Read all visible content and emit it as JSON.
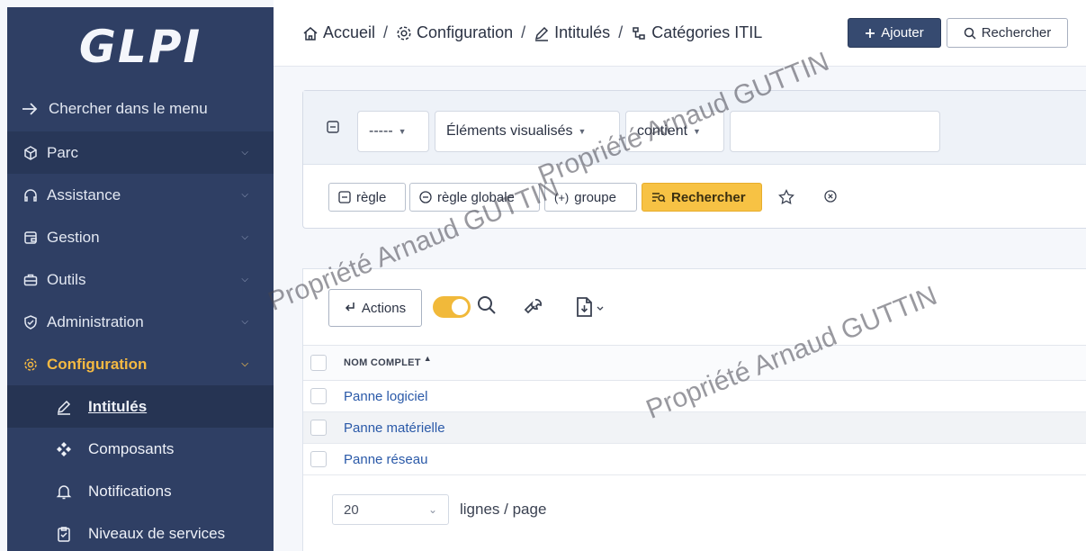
{
  "sidebar": {
    "logo": "GLPI",
    "search_label": "Chercher dans le menu",
    "items": [
      {
        "label": "Parc"
      },
      {
        "label": "Assistance"
      },
      {
        "label": "Gestion"
      },
      {
        "label": "Outils"
      },
      {
        "label": "Administration"
      },
      {
        "label": "Configuration",
        "active": true
      }
    ],
    "sub_items": [
      {
        "label": "Intitulés",
        "current": true
      },
      {
        "label": "Composants"
      },
      {
        "label": "Notifications"
      },
      {
        "label": "Niveaux de services"
      }
    ]
  },
  "breadcrumb": [
    {
      "label": "Accueil"
    },
    {
      "label": "Configuration"
    },
    {
      "label": "Intitulés"
    },
    {
      "label": "Catégories ITIL"
    }
  ],
  "header": {
    "add_label": "Ajouter",
    "search_label": "Rechercher"
  },
  "criteria": {
    "link_select": "-----",
    "field_select": "Éléments visualisés",
    "operator_select": "contient",
    "value": "",
    "rule_label": "règle",
    "global_rule_label": "règle globale",
    "group_label": "groupe",
    "search_label": "Rechercher"
  },
  "results": {
    "actions_label": "Actions",
    "column_header": "NOM COMPLET",
    "rows": [
      {
        "name": "Panne logiciel"
      },
      {
        "name": "Panne matérielle"
      },
      {
        "name": "Panne réseau"
      }
    ],
    "per_page": "20",
    "per_page_label": "lignes / page"
  },
  "watermark": "Propriété Arnaud GUTTIN",
  "colors": {
    "sidebar_bg": "#2f3f64",
    "active_accent": "#f4b942",
    "primary_button": "#364a70",
    "search_button": "#f7c244",
    "link": "#2a59a8"
  }
}
